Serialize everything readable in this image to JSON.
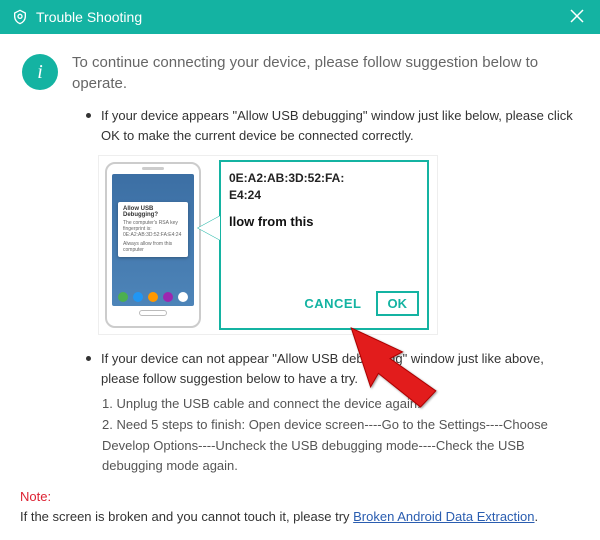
{
  "titlebar": {
    "title": "Trouble Shooting"
  },
  "intro": "To continue connecting your device, please follow suggestion below to operate.",
  "bullets": {
    "b1": "If your device appears \"Allow USB debugging\" window just like below, please click OK to make the current device  be connected correctly.",
    "b2": "If your device can not appear \"Allow USB debugging\" window just like above, please follow suggestion below to have a try."
  },
  "steps": {
    "s1": "1. Unplug the USB cable and connect the device again.",
    "s2": "2. Need 5 steps to finish: Open device screen----Go to the Settings----Choose Develop Options----Uncheck the USB debugging mode----Check the USB debugging mode again."
  },
  "phone_dialog": {
    "title": "Allow USB Debugging?",
    "l1": "The computer's RSA key",
    "l2": "fingerprint is:",
    "l3": "0E:A2:AB:3D:52:FA:E4:24",
    "l4": "Always allow from this computer"
  },
  "panel": {
    "mac1": "0E:A2:AB:3D:52:FA:",
    "mac2": "E4:24",
    "allow": "llow from this",
    "cancel": "CANCEL",
    "ok": "OK"
  },
  "note": {
    "label": "Note:",
    "text_before": "If the screen is broken and you cannot touch it, please try ",
    "link": "Broken Android Data Extraction",
    "text_after": "."
  }
}
